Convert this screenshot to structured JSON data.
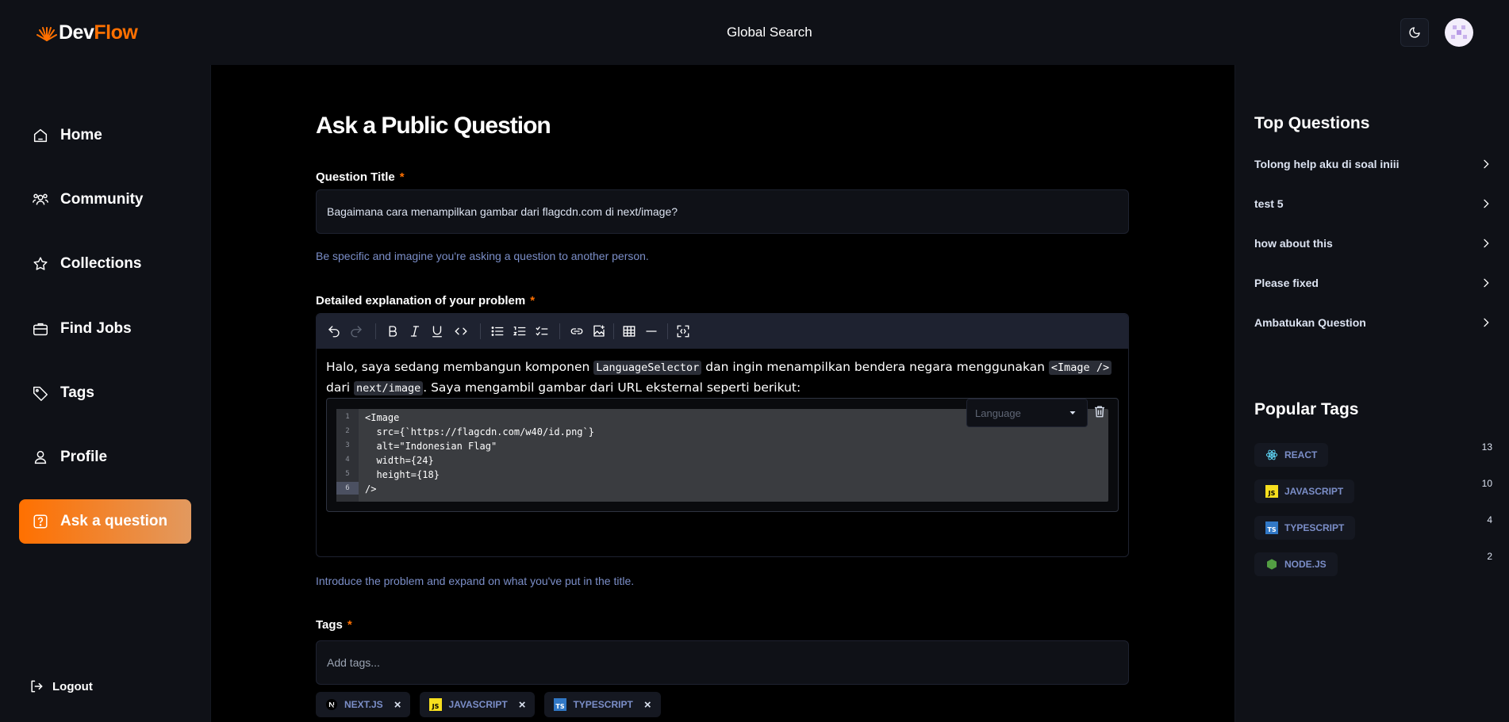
{
  "navbar": {
    "logo_dev": "Dev",
    "logo_flow": "Flow",
    "global_search": "Global Search"
  },
  "sidebar": {
    "items": [
      {
        "label": "Home",
        "icon": "home-icon"
      },
      {
        "label": "Community",
        "icon": "users-icon"
      },
      {
        "label": "Collections",
        "icon": "star-icon"
      },
      {
        "label": "Find Jobs",
        "icon": "briefcase-icon"
      },
      {
        "label": "Tags",
        "icon": "tag-icon"
      },
      {
        "label": "Profile",
        "icon": "user-icon"
      },
      {
        "label": "Ask a question",
        "icon": "question-icon"
      }
    ],
    "logout": "Logout"
  },
  "main": {
    "page_title": "Ask a Public Question",
    "title_label": "Question Title",
    "title_value": "Bagaimana cara menampilkan gambar dari flagcdn.com di next/image?",
    "title_hint": "Be specific and imagine you're asking a question to another person.",
    "explanation_label": "Detailed explanation of your problem",
    "explanation_hint": "Introduce the problem and expand on what you've put in the title.",
    "editor": {
      "text_1": "Halo, saya sedang membangun komponen ",
      "code_1": "LanguageSelector",
      "text_2": " dan ingin menampilkan bendera negara menggunakan ",
      "code_2": "<Image />",
      "text_3": " dari ",
      "code_3": "next/image",
      "text_4": ". Saya mengambil gambar dari URL eksternal seperti berikut:",
      "language_placeholder": "Language",
      "code_lines": [
        "<Image",
        "  src={`https://flagcdn.com/w40/id.png`}",
        "  alt=\"Indonesian Flag\"",
        "  width={24}",
        "  height={18}",
        "/>"
      ],
      "line_numbers": [
        "1",
        "2",
        "3",
        "4",
        "5",
        "6"
      ]
    },
    "tags_label": "Tags",
    "tags_placeholder": "Add tags...",
    "selected_tags": [
      "NEXT.JS",
      "JAVASCRIPT",
      "TYPESCRIPT"
    ],
    "required_mark": "*"
  },
  "right_sidebar": {
    "top_questions_title": "Top Questions",
    "top_questions": [
      "Tolong help aku di soal iniii",
      "test 5",
      "how about this",
      "Please fixed",
      "Ambatukan Question"
    ],
    "popular_tags_title": "Popular Tags",
    "popular_tags": [
      {
        "name": "REACT",
        "count": "13"
      },
      {
        "name": "JAVASCRIPT",
        "count": "10"
      },
      {
        "name": "TYPESCRIPT",
        "count": "4"
      },
      {
        "name": "NODE.JS",
        "count": "2"
      }
    ]
  },
  "colors": {
    "accent": "#ff7000",
    "accent_end": "#e2995f",
    "link_blue": "#7b8ec8",
    "background": "#0f1117",
    "main_background": "#000000"
  }
}
